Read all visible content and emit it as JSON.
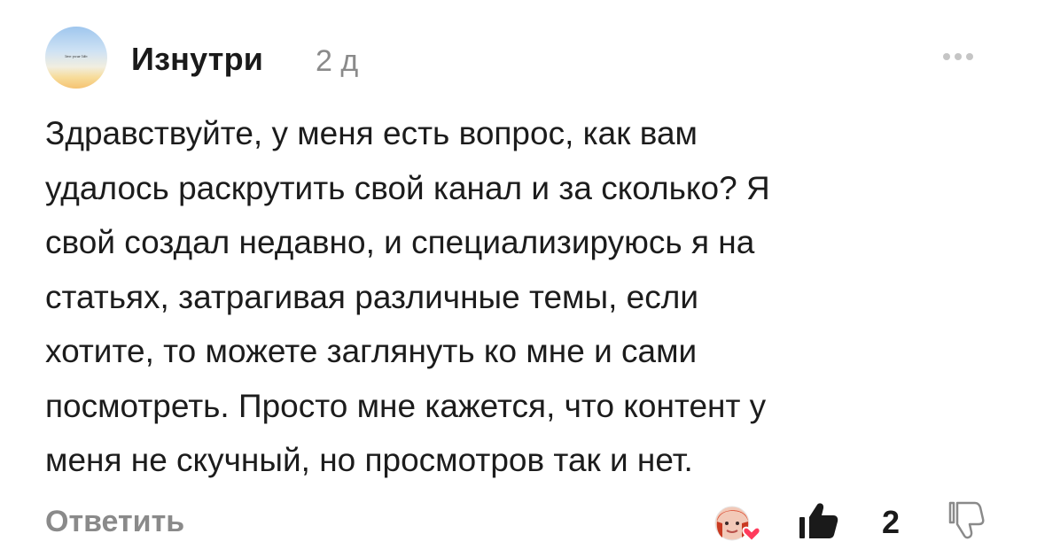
{
  "comment": {
    "author": "Изнутри",
    "time": "2 д",
    "avatar_text": "live your life",
    "lines": [
      "Здравствуйте, у меня есть вопрос, как вам",
      "удалось раскрутить свой канал и за сколько? Я",
      "свой создал недавно, и специализируюсь я на",
      "статьях, затрагивая различные темы, если",
      "хотите, то можете заглянуть ко мне и сами",
      "посмотреть. Просто мне кажется, что контент у",
      "меня не скучный, но просмотров так и нет."
    ]
  },
  "actions": {
    "reply_label": "Ответить",
    "like_count": "2"
  },
  "icons": {
    "more": "more-dots-icon",
    "author_like": "author-heart-avatar-icon",
    "like": "thumbs-up-icon",
    "dislike": "thumbs-down-icon"
  },
  "colors": {
    "text": "#1c1c1c",
    "muted": "#8a8a8a",
    "heart": "#ff3b5c"
  }
}
